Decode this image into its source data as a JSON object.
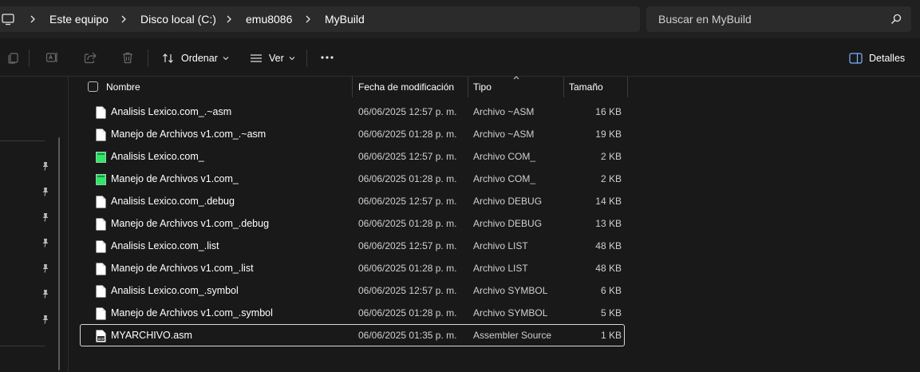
{
  "address_bar": {
    "breadcrumbs": [
      "Este equipo",
      "Disco local (C:)",
      "emu8086",
      "MyBuild"
    ],
    "icon": "computer-icon"
  },
  "search": {
    "placeholder": "Buscar en MyBuild",
    "icon": "search-icon"
  },
  "toolbar": {
    "icons": [
      "copy-icon",
      "rename-icon",
      "share-icon",
      "delete-icon"
    ],
    "sort_label": "Ordenar",
    "view_label": "Ver",
    "more_icon": "more-icon",
    "details_label": "Detalles"
  },
  "columns": {
    "name": "Nombre",
    "date": "Fecha de modificación",
    "type": "Tipo",
    "size": "Tamaño"
  },
  "files": [
    {
      "name": "Analisis Lexico.com_.~asm",
      "date": "06/06/2025 12:57 p. m.",
      "type": "Archivo ~ASM",
      "size": "16 KB",
      "icon": "file-icon"
    },
    {
      "name": "Manejo de Archivos v1.com_.~asm",
      "date": "06/06/2025 01:28 p. m.",
      "type": "Archivo ~ASM",
      "size": "19 KB",
      "icon": "file-icon"
    },
    {
      "name": "Analisis Lexico.com_",
      "date": "06/06/2025 12:57 p. m.",
      "type": "Archivo COM_",
      "size": "2 KB",
      "icon": "executable-icon"
    },
    {
      "name": "Manejo de Archivos v1.com_",
      "date": "06/06/2025 01:28 p. m.",
      "type": "Archivo COM_",
      "size": "2 KB",
      "icon": "executable-icon"
    },
    {
      "name": "Analisis Lexico.com_.debug",
      "date": "06/06/2025 12:57 p. m.",
      "type": "Archivo DEBUG",
      "size": "14 KB",
      "icon": "file-icon"
    },
    {
      "name": "Manejo de Archivos v1.com_.debug",
      "date": "06/06/2025 01:28 p. m.",
      "type": "Archivo DEBUG",
      "size": "13 KB",
      "icon": "file-icon"
    },
    {
      "name": "Analisis Lexico.com_.list",
      "date": "06/06/2025 12:57 p. m.",
      "type": "Archivo LIST",
      "size": "48 KB",
      "icon": "file-icon"
    },
    {
      "name": "Manejo de Archivos v1.com_.list",
      "date": "06/06/2025 01:28 p. m.",
      "type": "Archivo LIST",
      "size": "48 KB",
      "icon": "file-icon"
    },
    {
      "name": "Analisis Lexico.com_.symbol",
      "date": "06/06/2025 12:57 p. m.",
      "type": "Archivo SYMBOL",
      "size": "6 KB",
      "icon": "file-icon"
    },
    {
      "name": "Manejo de Archivos v1.com_.symbol",
      "date": "06/06/2025 01:28 p. m.",
      "type": "Archivo SYMBOL",
      "size": "5 KB",
      "icon": "file-icon"
    },
    {
      "name": "MYARCHIVO.asm",
      "date": "06/06/2025 01:35 p. m.",
      "type": "Assembler Source",
      "size": "1 KB",
      "icon": "asm-file-icon",
      "selected": true
    }
  ],
  "nav_pane": {
    "pin_icon": "pin-icon",
    "pinned_count": 7
  },
  "colors": {
    "background": "#191919",
    "bar": "#202020",
    "box": "#2b2b2b",
    "exe_green": "#2ee86a"
  }
}
